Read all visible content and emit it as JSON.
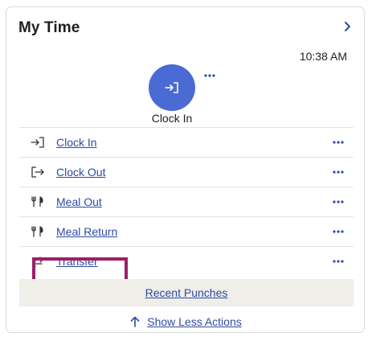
{
  "card": {
    "title": "My Time",
    "time": "10:38 AM",
    "punch": {
      "label": "Clock In",
      "icon": "clock-in-icon",
      "color": "#4a6bd4"
    },
    "actions": [
      {
        "label": "Clock In",
        "icon": "clock-in-icon"
      },
      {
        "label": "Clock Out",
        "icon": "clock-out-icon"
      },
      {
        "label": "Meal Out",
        "icon": "utensils-icon"
      },
      {
        "label": "Meal Return",
        "icon": "utensils-icon"
      },
      {
        "label": "Transfer",
        "icon": "transfer-icon"
      }
    ],
    "recent_punches": "Recent Punches",
    "show_less": "Show Less Actions"
  },
  "colors": {
    "link": "#2d4ba5",
    "highlight": "#9c1f6a",
    "footer_bg": "#efeee9"
  }
}
